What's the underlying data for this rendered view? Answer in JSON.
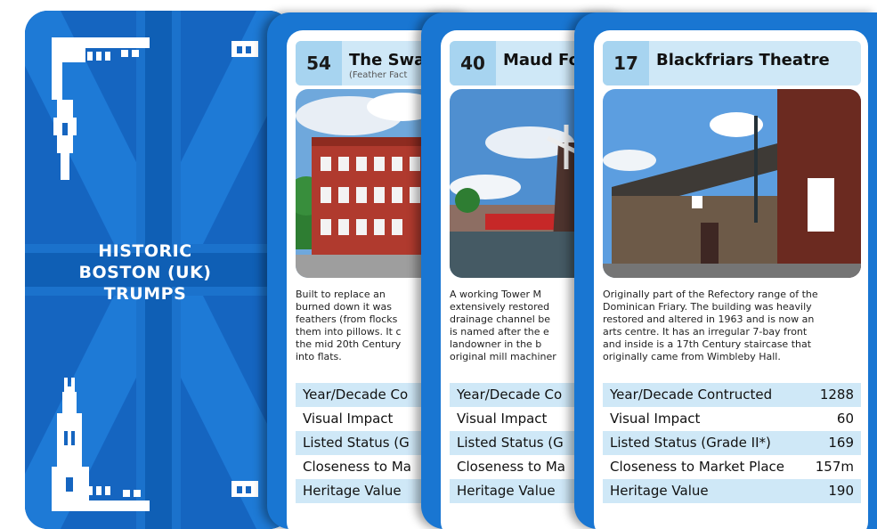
{
  "back": {
    "title_lines": [
      "HISTORIC",
      "BOSTON (UK)",
      "TRUMPS"
    ]
  },
  "cards": [
    {
      "number": "54",
      "name": "The Swa",
      "subtitle": "(Feather Fact",
      "desc_lines": [
        "Built to replace an",
        "burned down it was",
        "feathers (from flocks",
        "them into pillows. It c",
        "the mid 20th Century",
        "into flats."
      ],
      "stats": [
        {
          "label": "Year/Decade Co",
          "value": ""
        },
        {
          "label": "Visual Impact",
          "value": ""
        },
        {
          "label": "Listed Status (G",
          "value": ""
        },
        {
          "label": "Closeness to Ma",
          "value": ""
        },
        {
          "label": "Heritage Value",
          "value": ""
        }
      ]
    },
    {
      "number": "40",
      "name": "Maud Fo",
      "subtitle": "",
      "desc_lines": [
        "A working Tower M",
        "extensively restored",
        "drainage channel be",
        "is named after the e",
        "landowner in the b",
        "original mill machiner"
      ],
      "stats": [
        {
          "label": "Year/Decade Co",
          "value": ""
        },
        {
          "label": "Visual Impact",
          "value": ""
        },
        {
          "label": "Listed Status (G",
          "value": ""
        },
        {
          "label": "Closeness to Ma",
          "value": ""
        },
        {
          "label": "Heritage Value",
          "value": ""
        }
      ]
    },
    {
      "number": "17",
      "name": "Blackfriars Theatre",
      "subtitle": "",
      "desc_lines": [
        "Originally part of the Refectory range of the",
        "Dominican Friary. The building was heavily",
        "restored and altered in 1963 and is now an",
        "arts centre. It has an irregular 7-bay front",
        "and inside is a 17th Century staircase that",
        "originally came from Wimbleby Hall."
      ],
      "stats": [
        {
          "label": "Year/Decade Contructed",
          "value": "1288"
        },
        {
          "label": "Visual Impact",
          "value": "60"
        },
        {
          "label": "Listed Status (Grade II*)",
          "value": "169"
        },
        {
          "label": "Closeness to Market Place",
          "value": "157m"
        },
        {
          "label": "Heritage Value",
          "value": "190"
        }
      ]
    }
  ]
}
